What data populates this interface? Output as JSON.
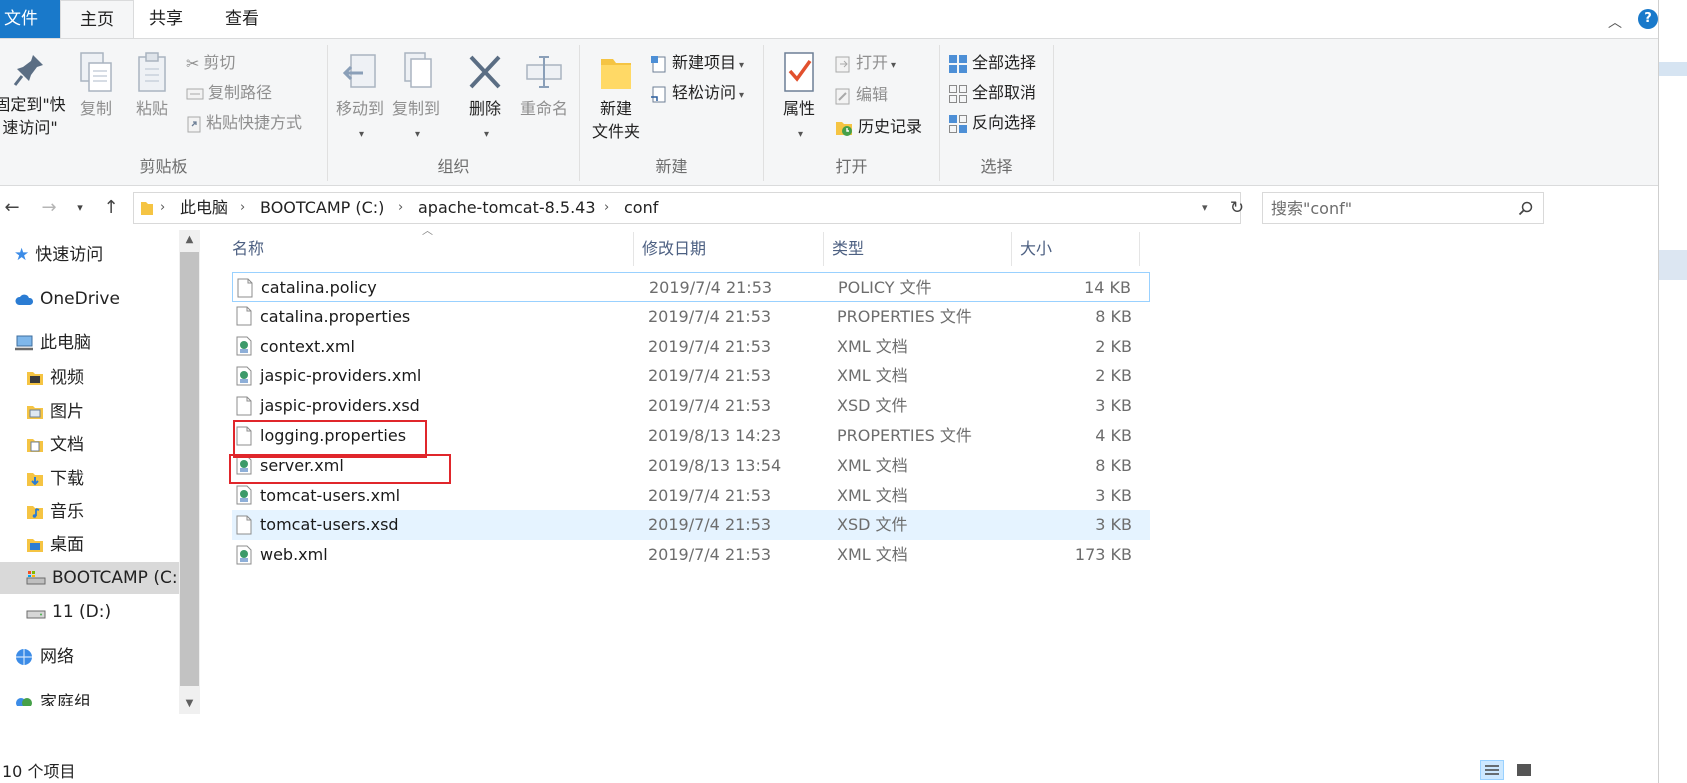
{
  "ribbon_tabs": {
    "file": "文件",
    "home": "主页",
    "share": "共享",
    "view": "查看"
  },
  "ribbon": {
    "clipboard": {
      "label": "剪贴板",
      "pin_line1": "固定到\"快",
      "pin_line2": "速访问\"",
      "copy": "复制",
      "paste": "粘贴",
      "cut": "剪切",
      "copy_path": "复制路径",
      "paste_shortcut": "粘贴快捷方式"
    },
    "organize": {
      "label": "组织",
      "move_to": "移动到",
      "copy_to": "复制到",
      "delete": "删除",
      "rename": "重命名"
    },
    "new": {
      "label": "新建",
      "new_folder_line1": "新建",
      "new_folder_line2": "文件夹",
      "new_item": "新建项目",
      "easy_access": "轻松访问"
    },
    "open": {
      "label": "打开",
      "properties": "属性",
      "open": "打开",
      "edit": "编辑",
      "history": "历史记录"
    },
    "select": {
      "label": "选择",
      "select_all": "全部选择",
      "select_none": "全部取消",
      "invert": "反向选择"
    }
  },
  "address": {
    "crumbs": [
      "此电脑",
      "BOOTCAMP (C:)",
      "apache-tomcat-8.5.43",
      "conf"
    ],
    "search_placeholder": "搜索\"conf\""
  },
  "navpane": [
    {
      "label": "快速访问",
      "icon": "star-icon"
    },
    {
      "label": "OneDrive",
      "icon": "cloud-icon"
    },
    {
      "label": "此电脑",
      "icon": "computer-icon"
    },
    {
      "label": "视频",
      "icon": "video-folder-icon"
    },
    {
      "label": "图片",
      "icon": "pictures-folder-icon"
    },
    {
      "label": "文档",
      "icon": "documents-folder-icon"
    },
    {
      "label": "下载",
      "icon": "downloads-folder-icon"
    },
    {
      "label": "音乐",
      "icon": "music-folder-icon"
    },
    {
      "label": "桌面",
      "icon": "desktop-folder-icon"
    },
    {
      "label": "BOOTCAMP (C:)",
      "icon": "drive-c-icon"
    },
    {
      "label": "11 (D:)",
      "icon": "drive-d-icon"
    },
    {
      "label": "网络",
      "icon": "network-icon"
    },
    {
      "label": "家庭组",
      "icon": "homegroup-icon"
    }
  ],
  "columns": {
    "name": "名称",
    "date": "修改日期",
    "type": "类型",
    "size": "大小"
  },
  "files": [
    {
      "name": "catalina.policy",
      "date": "2019/7/4 21:53",
      "type": "POLICY 文件",
      "size": "14 KB",
      "icon": "blank-file-icon"
    },
    {
      "name": "catalina.properties",
      "date": "2019/7/4 21:53",
      "type": "PROPERTIES 文件",
      "size": "8 KB",
      "icon": "blank-file-icon"
    },
    {
      "name": "context.xml",
      "date": "2019/7/4 21:53",
      "type": "XML 文档",
      "size": "2 KB",
      "icon": "xml-file-icon"
    },
    {
      "name": "jaspic-providers.xml",
      "date": "2019/7/4 21:53",
      "type": "XML 文档",
      "size": "2 KB",
      "icon": "xml-file-icon"
    },
    {
      "name": "jaspic-providers.xsd",
      "date": "2019/7/4 21:53",
      "type": "XSD 文件",
      "size": "3 KB",
      "icon": "blank-file-icon"
    },
    {
      "name": "logging.properties",
      "date": "2019/8/13 14:23",
      "type": "PROPERTIES 文件",
      "size": "4 KB",
      "icon": "blank-file-icon"
    },
    {
      "name": "server.xml",
      "date": "2019/8/13 13:54",
      "type": "XML 文档",
      "size": "8 KB",
      "icon": "xml-file-icon"
    },
    {
      "name": "tomcat-users.xml",
      "date": "2019/7/4 21:53",
      "type": "XML 文档",
      "size": "3 KB",
      "icon": "xml-file-icon"
    },
    {
      "name": "tomcat-users.xsd",
      "date": "2019/7/4 21:53",
      "type": "XSD 文件",
      "size": "3 KB",
      "icon": "blank-file-icon"
    },
    {
      "name": "web.xml",
      "date": "2019/7/4 21:53",
      "type": "XML 文档",
      "size": "173 KB",
      "icon": "xml-file-icon"
    }
  ],
  "status": {
    "item_count": "10 个项目"
  },
  "colors": {
    "accent": "#1979ca",
    "selection": "#e5f3ff",
    "highlight_box": "#e0262b"
  }
}
